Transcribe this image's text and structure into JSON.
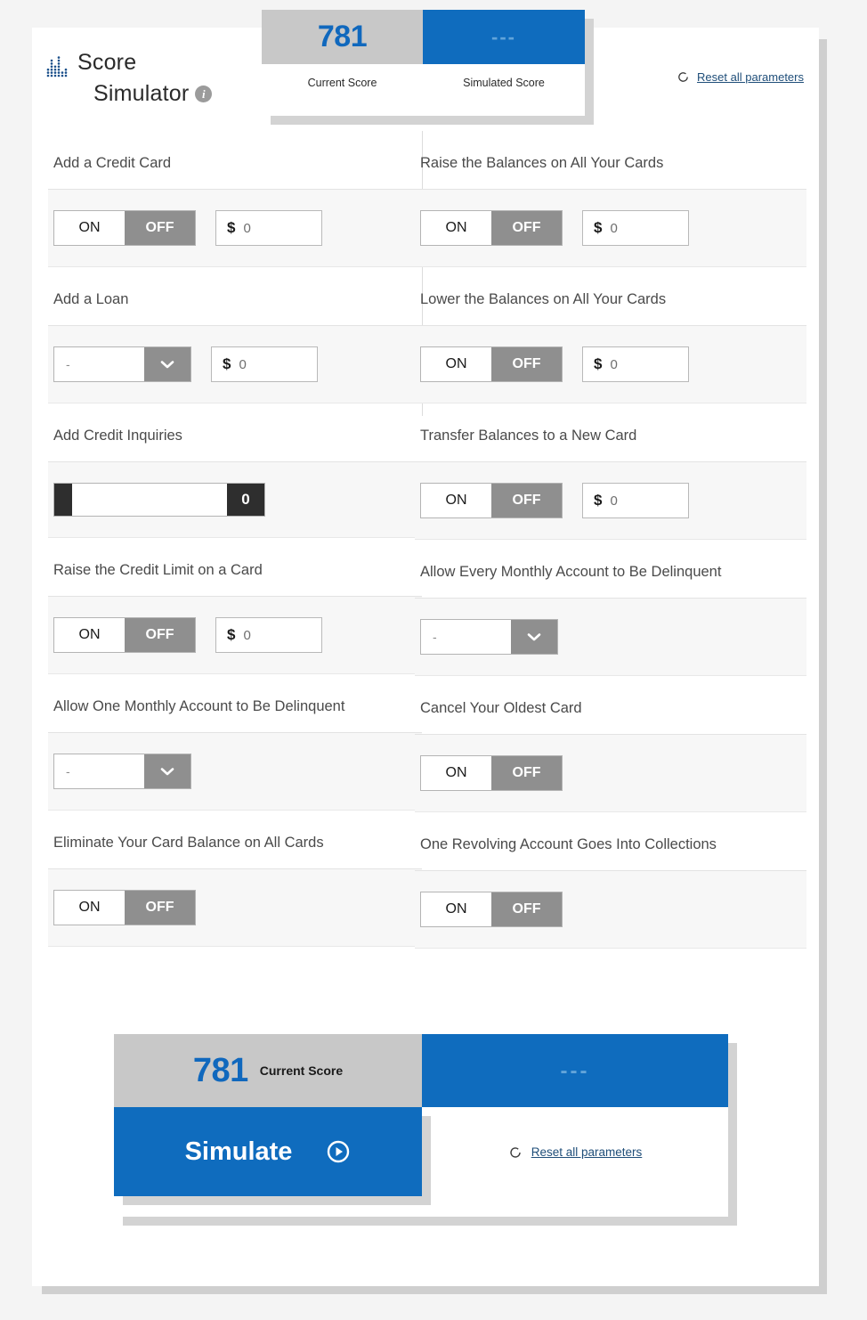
{
  "brand": {
    "logo_icon": "bar-chart-dots-icon",
    "line1": "Score",
    "line2": "Simulator",
    "info_icon": "info-icon",
    "info_glyph": "i"
  },
  "score_widget": {
    "current_value": "781",
    "current_label": "Current Score",
    "simulated_value": "---",
    "simulated_label": "Simulated Score",
    "current_box_color": "#c8c8c8",
    "simulated_box_color": "#0f6cbe",
    "score_text_color": "#1068bd"
  },
  "reset_top": {
    "icon": "refresh-icon",
    "label": "Reset all parameters"
  },
  "controls": {
    "toggle_on": "ON",
    "toggle_off": "OFF",
    "money_sign": "$",
    "money_value": "0",
    "select_value": "-",
    "select_arrow_icon": "chevron-down-icon",
    "slider_value": "0"
  },
  "left_column": [
    {
      "label": "Add a Credit Card",
      "control": "toggle-money"
    },
    {
      "label": "Add a Loan",
      "control": "select-money"
    },
    {
      "label": "Add Credit Inquiries",
      "control": "slider"
    },
    {
      "label": "Raise the Credit Limit on a Card",
      "control": "toggle-money"
    },
    {
      "label": "Allow One Monthly Account to Be Delinquent",
      "control": "select"
    },
    {
      "label": "Eliminate Your Card Balance on All Cards",
      "control": "toggle"
    }
  ],
  "right_column": [
    {
      "label": "Raise the Balances on All Your Cards",
      "control": "toggle-money"
    },
    {
      "label": "Lower the Balances on All Your Cards",
      "control": "toggle-money"
    },
    {
      "label": "Transfer Balances to a New Card",
      "control": "toggle-money"
    },
    {
      "label": "Allow Every Monthly Account to Be Delinquent",
      "control": "select"
    },
    {
      "label": "Cancel Your Oldest Card",
      "control": "toggle"
    },
    {
      "label": "One Revolving Account Goes Into Collections",
      "control": "toggle"
    }
  ],
  "footer": {
    "current_value": "781",
    "current_label": "Current Score",
    "simulated_value": "---",
    "simulate_label": "Simulate",
    "simulate_icon": "play-circle-icon",
    "reset_icon": "refresh-icon",
    "reset_label": "Reset all parameters",
    "button_color": "#0f6cbe"
  }
}
